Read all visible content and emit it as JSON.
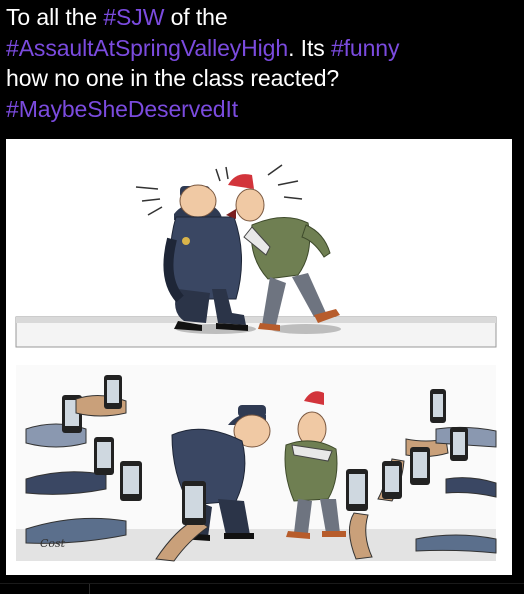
{
  "post": {
    "line1": {
      "pre": "To all the ",
      "tag1": "#SJW",
      "post": " of the"
    },
    "line2": {
      "tag": "#AssaultAtSpringValleyHigh",
      "mid": ". Its ",
      "tag2": "#funny"
    },
    "line3": {
      "text": "how no one in the class reacted?"
    },
    "line4": {
      "tag": "#MaybeSheDeservedIt"
    }
  },
  "cartoon": {
    "signature": "Cost"
  },
  "colors": {
    "background": "#000000",
    "text": "#ffffff",
    "hashtag": "#7b4bdf",
    "image_bg": "#ffffff"
  }
}
